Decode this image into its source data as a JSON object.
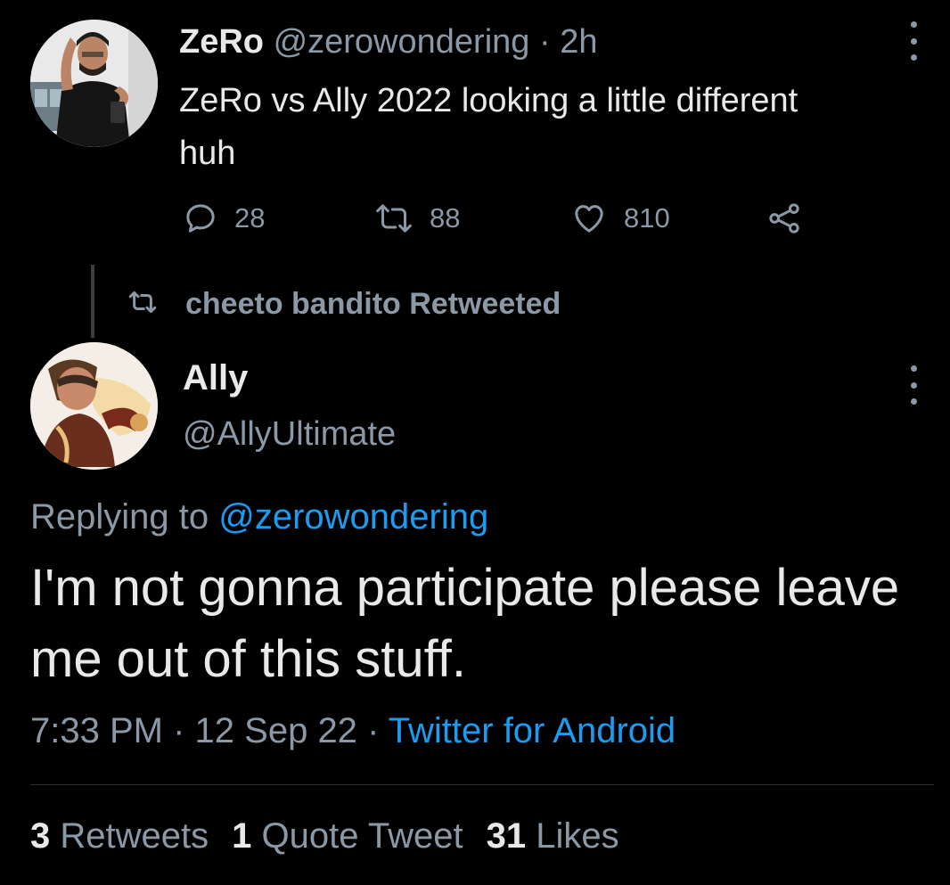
{
  "top_tweet": {
    "author_name": "ZeRo",
    "author_handle": "@zerowondering",
    "separator": "·",
    "time_ago": "2h",
    "text": "ZeRo vs Ally 2022 looking a little different huh",
    "replies": "28",
    "retweets": "88",
    "likes": "810",
    "icons": [
      "reply-icon",
      "retweet-icon",
      "like-icon",
      "share-icon",
      "more-icon"
    ]
  },
  "retweet_context": {
    "label": "cheeto bandito Retweeted"
  },
  "main_tweet": {
    "author_name": "Ally",
    "author_handle": "@AllyUltimate",
    "replying_prefix": "Replying to",
    "replying_handle": "@zerowondering",
    "text": "I'm not gonna participate please leave me out of this stuff.",
    "time": "7:33 PM",
    "date": "12 Sep 22",
    "source": "Twitter for Android",
    "separator": "·",
    "stats": {
      "retweets_count": "3",
      "retweets_label": "Retweets",
      "quotes_count": "1",
      "quotes_label": "Quote Tweet",
      "likes_count": "31",
      "likes_label": "Likes"
    }
  },
  "colors": {
    "background": "#000000",
    "text_primary": "#e7e9ea",
    "text_secondary": "#8b98a5",
    "link": "#1d9bf0"
  }
}
